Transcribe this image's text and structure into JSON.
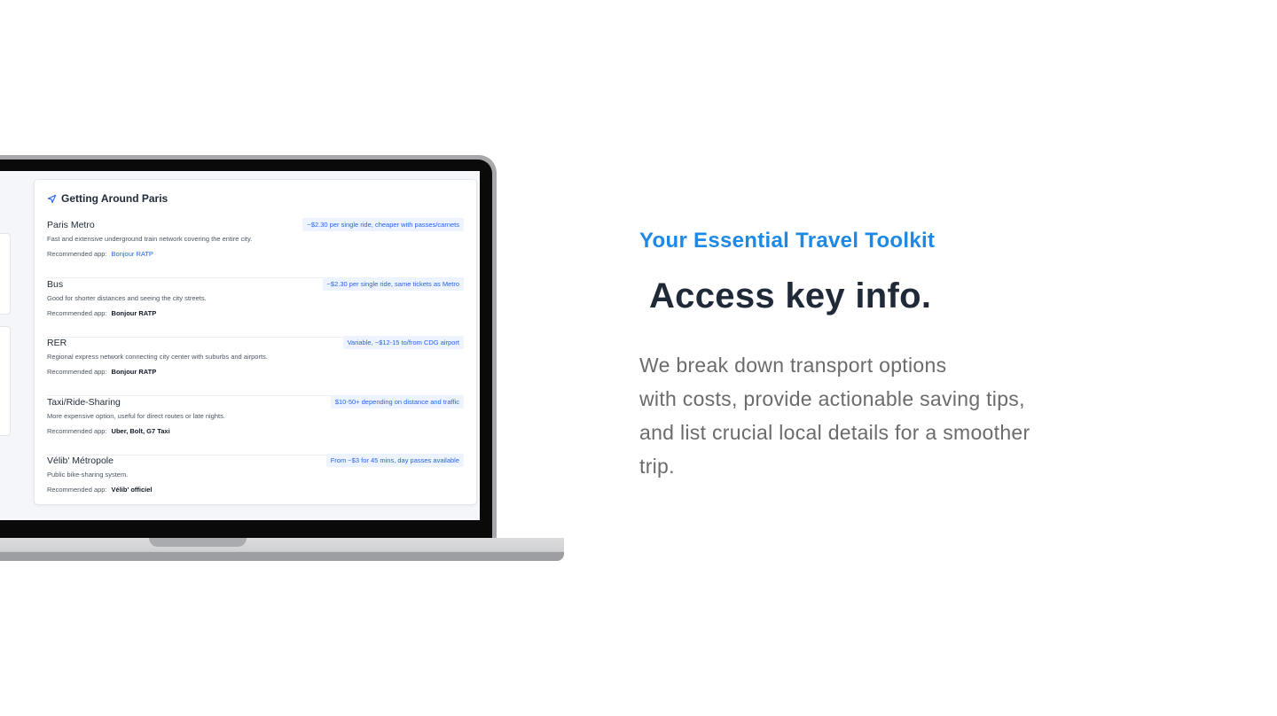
{
  "screen_card": {
    "title": "Getting Around Paris",
    "icon": "navigation-arrow-icon",
    "recommended_label": "Recommended app:",
    "rows": [
      {
        "name": "Paris Metro",
        "badge": "~$2.30 per single ride, cheaper with passes/carnets",
        "desc": "Fast and extensive underground train network covering the entire city.",
        "app": "Bonjour RATP",
        "app_is_link": true
      },
      {
        "name": "Bus",
        "badge": "~$2.30 per single ride, same tickets as Metro",
        "desc": "Good for shorter distances and seeing the city streets.",
        "app": "Bonjour RATP",
        "app_is_link": false
      },
      {
        "name": "RER",
        "badge": "Variable, ~$12-15 to/from CDG airport",
        "desc": "Regional express network connecting city center with suburbs and airports.",
        "app": "Bonjour RATP",
        "app_is_link": false
      },
      {
        "name": "Taxi/Ride-Sharing",
        "badge": "$10-50+ depending on distance and traffic",
        "desc": "More expensive option, useful for direct routes or late nights.",
        "app": "Uber, Bolt, G7 Taxi",
        "app_is_link": false
      },
      {
        "name": "Vélib' Métropole",
        "badge": "From ~$3 for 45 mins, day passes available",
        "desc": "Public bike-sharing system.",
        "app": "Vélib' officiel",
        "app_is_link": false
      }
    ]
  },
  "eyebrow": "Your Essential Travel Toolkit",
  "headline": "Access key info.",
  "body_lines": [
    "We break down transport options",
    "with costs, provide actionable saving tips,",
    "and list crucial local details for a smoother",
    "trip."
  ],
  "colors": {
    "accent": "#1e88e5",
    "heading": "#1f2937",
    "body": "#6b6b6b",
    "badge_text": "#2563eb",
    "badge_bg": "#eef4ff"
  }
}
